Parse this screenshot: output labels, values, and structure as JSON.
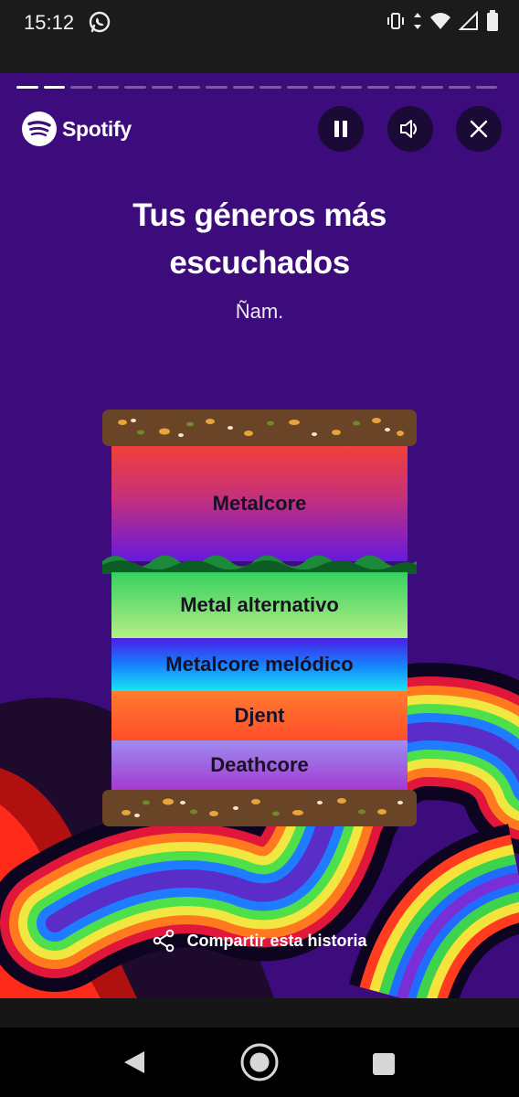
{
  "status_bar": {
    "time": "15:12"
  },
  "story": {
    "progress": {
      "total_segments": 18,
      "completed": 2
    },
    "brand": "Spotify",
    "title_line1": "Tus géneros más",
    "title_line2": "escuchados",
    "subtitle": "Ñam.",
    "genres": [
      "Metalcore",
      "Metal alternativo",
      "Metalcore melódico",
      "Djent",
      "Deathcore"
    ],
    "share_label": "Compartir esta historia"
  },
  "colors": {
    "background": "#3c0b7c",
    "bread": "#6a4426",
    "button_bg": "#1b0a35"
  },
  "icons": {
    "whatsapp": "whatsapp-icon",
    "vibrate": "vibrate-icon",
    "data": "data-arrows-icon",
    "wifi": "wifi-icon",
    "signal": "signal-icon",
    "battery": "battery-icon",
    "pause": "pause-icon",
    "volume": "volume-icon",
    "close": "close-icon",
    "share": "share-icon"
  }
}
